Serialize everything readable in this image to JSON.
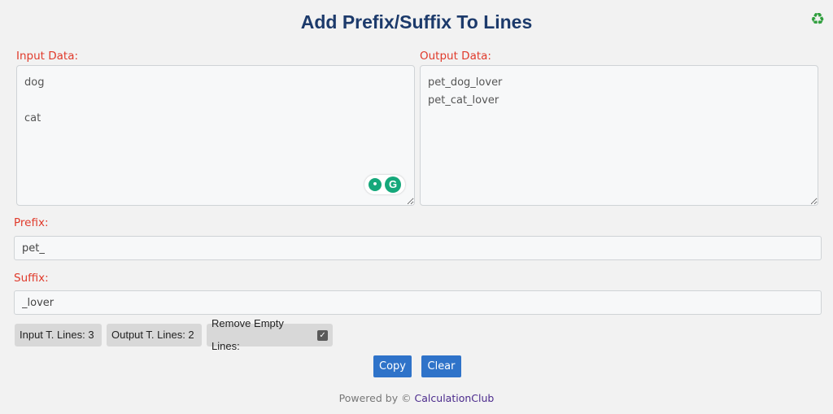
{
  "header": {
    "title": "Add Prefix/Suffix To Lines",
    "recycle_icon": "♻"
  },
  "input": {
    "label": "Input Data:",
    "value": "dog\n\ncat"
  },
  "output": {
    "label": "Output Data:",
    "value": "pet_dog_lover\npet_cat_lover"
  },
  "grammarly": {
    "bulb_glyph": "•",
    "logo_glyph": "G"
  },
  "prefix": {
    "label": "Prefix:",
    "value": "pet_"
  },
  "suffix": {
    "label": "Suffix:",
    "value": "_lover"
  },
  "stats": {
    "input_lines": "Input T. Lines: 3",
    "output_lines": "Output T. Lines: 2",
    "remove_empty_label": "Remove Empty Lines:",
    "remove_empty_checked": true
  },
  "buttons": {
    "copy": "Copy",
    "clear": "Clear"
  },
  "footer": {
    "powered_by": "Powered by © ",
    "brand": "CalculationClub"
  },
  "colors": {
    "title": "#1c3a6b",
    "label": "#e03a2b",
    "button": "#2f73c9",
    "brand": "#4b2a8c",
    "recycle": "#2e9e3c"
  }
}
